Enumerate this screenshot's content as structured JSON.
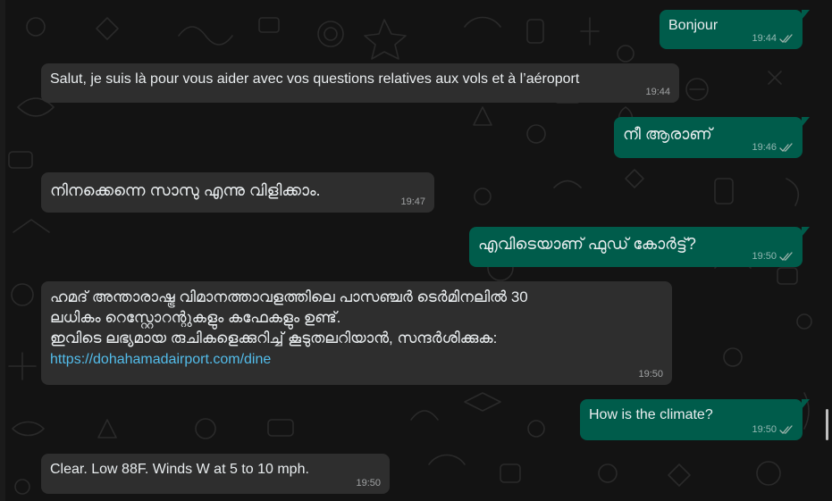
{
  "chat": {
    "messages": [
      {
        "direction": "outgoing",
        "text": "Bonjour",
        "time": "19:44",
        "status": "read"
      },
      {
        "direction": "incoming",
        "text": "Salut, je suis là pour vous aider avec vos questions relatives aux vols et à l’aéroport",
        "time": "19:44"
      },
      {
        "direction": "outgoing",
        "text": "നീ ആരാണ്",
        "time": "19:46",
        "status": "read"
      },
      {
        "direction": "incoming",
        "text": "നിനക്കെന്നെ സാസു എന്നു വിളിക്കാം.",
        "time": "19:47"
      },
      {
        "direction": "outgoing",
        "text": "എവിടെയാണ് ഫുഡ് കോർട്ട്?",
        "time": "19:50",
        "status": "read"
      },
      {
        "direction": "incoming",
        "lines": [
          "ഹമദ് അന്താരാഷ്ട്ര വിമാനത്താവളത്തിലെ പാസഞ്ചർ ടെർമിനലിൽ 30",
          "ലധികം റെസ്റ്റോറന്റുകളും കഫേകളും ഉണ്ട്.",
          "ഇവിടെ ലഭ്യമായ രുചികളെക്കുറിച്ച് കൂടുതലറിയാൻ, സന്ദർശിക്കുക:"
        ],
        "link": "https://dohahamadairport.com/dine",
        "time": "19:50"
      },
      {
        "direction": "outgoing",
        "text": "How is the climate?",
        "time": "19:50",
        "status": "read"
      },
      {
        "direction": "incoming",
        "text": "Clear. Low 88F. Winds W at 5 to 10 mph.",
        "time": "19:50"
      }
    ]
  },
  "colors": {
    "background": "#131313",
    "incoming_bubble": "#2e2e2e",
    "outgoing_bubble": "#005c4b",
    "text": "#e9edef",
    "link": "#53bdeb"
  },
  "icons": {
    "read_receipt": "double-check-icon",
    "wallpaper": "doodle-pattern"
  }
}
